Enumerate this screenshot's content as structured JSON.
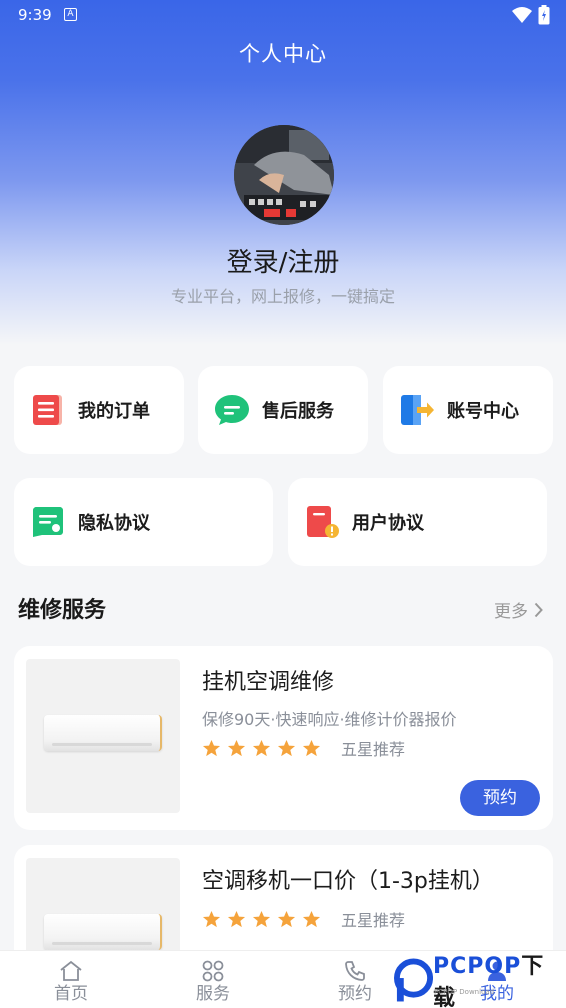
{
  "status_bar": {
    "time": "9:39",
    "notif": "A"
  },
  "header": {
    "title": "个人中心"
  },
  "profile": {
    "login_text": "登录/注册",
    "subtitle": "专业平台，网上报修，一键搞定"
  },
  "menu": [
    {
      "label": "我的订单",
      "icon": "order-icon",
      "color": "#ee4a4a"
    },
    {
      "label": "售后服务",
      "icon": "chat-icon",
      "color": "#1fc27a"
    },
    {
      "label": "账号中心",
      "icon": "account-icon",
      "color": "#1f7ae6"
    },
    {
      "label": "隐私协议",
      "icon": "privacy-icon",
      "color": "#1fc27a"
    },
    {
      "label": "用户协议",
      "icon": "agreement-icon",
      "color": "#ee4a4a"
    }
  ],
  "section": {
    "title": "维修服务",
    "more": "更多"
  },
  "products": [
    {
      "name": "挂机空调维修",
      "desc": "保修90天·快速响应·维修计价器报价",
      "rating": "五星推荐",
      "stars": 5,
      "button": "预约"
    },
    {
      "name": "空调移机一口价（1-3p挂机）",
      "rating": "五星推荐",
      "stars": 5
    }
  ],
  "tabbar": [
    {
      "label": "首页",
      "icon": "home-icon"
    },
    {
      "label": "服务",
      "icon": "grid-icon"
    },
    {
      "label": "预约",
      "icon": "phone-icon"
    },
    {
      "label": "我的",
      "icon": "user-icon",
      "active": true
    }
  ],
  "watermark": {
    "text": "PCPOP",
    "cn": "下载",
    "small": "PCPOP Download"
  },
  "colors": {
    "primary": "#3a62df",
    "star": "#f5a33b"
  }
}
